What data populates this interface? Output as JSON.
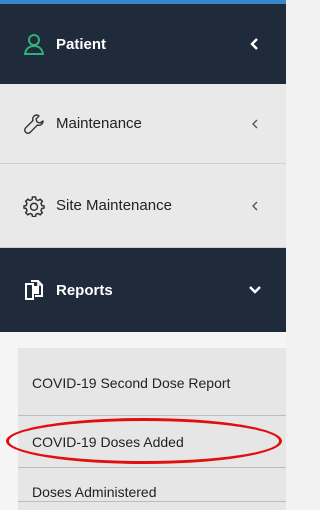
{
  "menu": {
    "patient": {
      "label": "Patient",
      "icon": "user-icon",
      "chevron": "chevron-left-icon"
    },
    "maintenance": {
      "label": "Maintenance",
      "icon": "wrench-icon",
      "chevron": "chevron-left-icon"
    },
    "site_maintenance": {
      "label": "Site Maintenance",
      "icon": "gear-icon",
      "chevron": "chevron-left-icon"
    },
    "reports": {
      "label": "Reports",
      "icon": "copy-files-icon",
      "chevron": "chevron-down-icon",
      "expanded": true,
      "items": [
        {
          "label": "COVID-19 Second Dose Report"
        },
        {
          "label": "COVID-19 Doses Added",
          "highlighted": true
        },
        {
          "label": "Doses Administered"
        }
      ]
    }
  },
  "colors": {
    "dark_bg": "#1f2a3a",
    "accent_green": "#34b07a",
    "annotation_red": "#e01010",
    "top_bar": "#3a86c8"
  }
}
